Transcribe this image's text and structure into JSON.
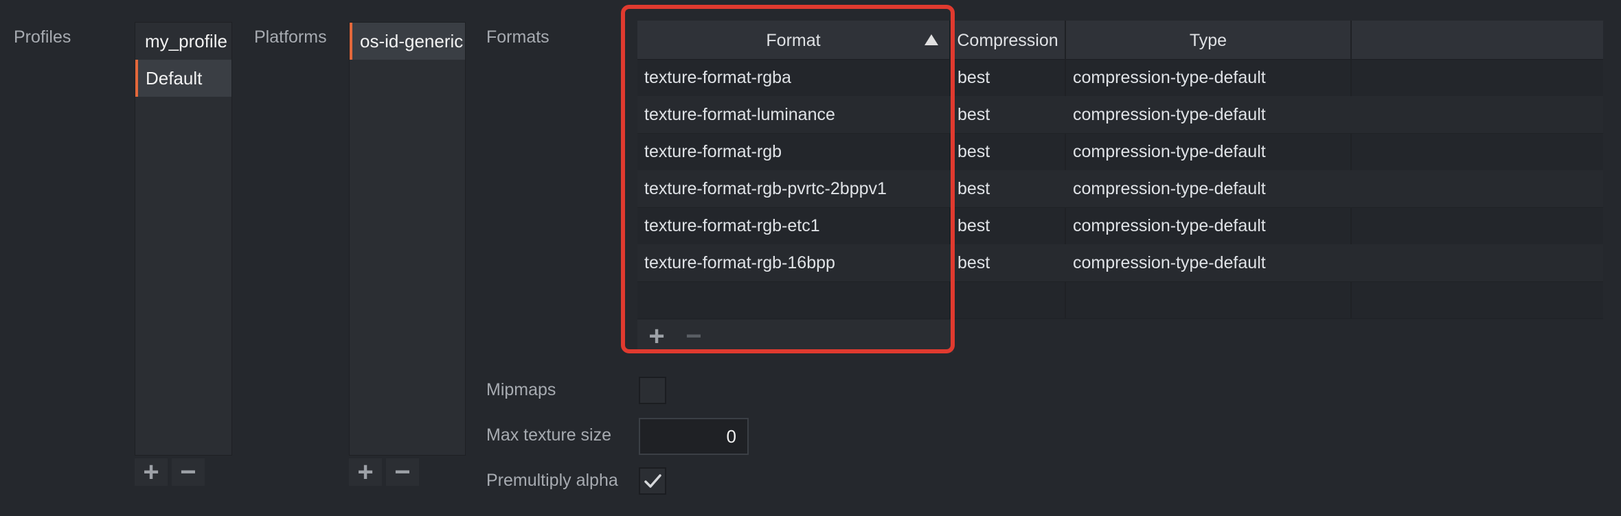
{
  "profiles": {
    "label": "Profiles",
    "items": [
      "my_profile",
      "Default"
    ]
  },
  "platforms": {
    "label": "Platforms",
    "items": [
      "os-id-generic"
    ]
  },
  "formats": {
    "label": "Formats",
    "columns": [
      "Format",
      "Compression",
      "Type"
    ],
    "rows": [
      [
        "texture-format-rgba",
        "best",
        "compression-type-default"
      ],
      [
        "texture-format-luminance",
        "best",
        "compression-type-default"
      ],
      [
        "texture-format-rgb",
        "best",
        "compression-type-default"
      ],
      [
        "texture-format-rgb-pvrtc-2bppv1",
        "best",
        "compression-type-default"
      ],
      [
        "texture-format-rgb-etc1",
        "best",
        "compression-type-default"
      ],
      [
        "texture-format-rgb-16bpp",
        "best",
        "compression-type-default"
      ]
    ]
  },
  "buttons": {
    "add": "+",
    "remove": "−"
  },
  "mipmaps": {
    "label": "Mipmaps",
    "checked": false
  },
  "max_texture_size": {
    "label": "Max texture size",
    "value": "0"
  },
  "premultiply_alpha": {
    "label": "Premultiply alpha",
    "checked": true
  },
  "colors": {
    "accent": "#e4683b",
    "highlight": "#e03a2f",
    "background": "#25282d"
  }
}
